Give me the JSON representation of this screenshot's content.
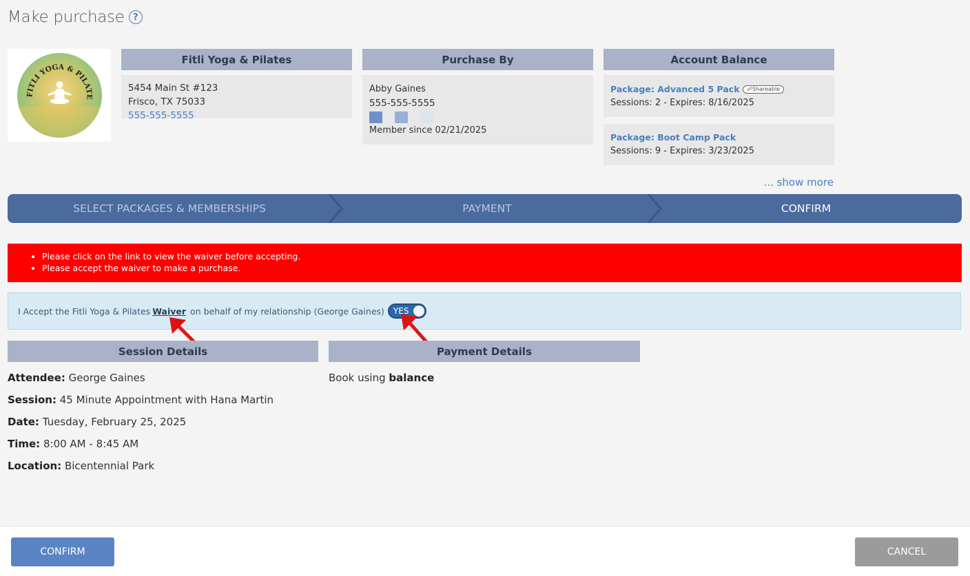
{
  "header": {
    "title": "Make purchase",
    "help_icon": "question-circle-icon"
  },
  "business": {
    "logo_text": "FITLI YOGA & PILATES",
    "name": "Fitli Yoga & Pilates",
    "address_line1": "5454 Main St #123",
    "address_line2": "Frisco, TX 75033",
    "phone": "555-555-5555"
  },
  "purchaser": {
    "heading": "Purchase By",
    "name": "Abby Gaines",
    "phone": "555-555-5555",
    "member_since": "Member since 02/21/2025"
  },
  "account": {
    "heading": "Account Balance",
    "packages": [
      {
        "title": "Package: Advanced 5 Pack",
        "badge": "Shareable",
        "details": "Sessions: 2 -  Expires: 8/16/2025"
      },
      {
        "title": "Package: Boot Camp Pack",
        "details": "Sessions: 9 -  Expires: 3/23/2025"
      }
    ],
    "show_more": "... show more"
  },
  "steps": [
    "SELECT PACKAGES & MEMBERSHIPS",
    "PAYMENT",
    "CONFIRM"
  ],
  "errors": [
    "Please click on the link to view the waiver before accepting.",
    "Please accept the waiver to make a purchase."
  ],
  "waiver": {
    "prefix": "I Accept the Fitli Yoga & Pilates",
    "link": "Waiver",
    "suffix": "on behalf of my relationship (George Gaines)",
    "toggle": "YES"
  },
  "session": {
    "heading": "Session Details",
    "rows": [
      {
        "label": "Attendee:",
        "value": "George Gaines"
      },
      {
        "label": "Session:",
        "value": "45 Minute Appointment with Hana Martin"
      },
      {
        "label": "Date:",
        "value": "Tuesday, February 25, 2025"
      },
      {
        "label": "Time:",
        "value": "8:00 AM - 8:45 AM"
      },
      {
        "label": "Location:",
        "value": "Bicentennial Park"
      }
    ]
  },
  "payment": {
    "heading": "Payment Details",
    "text": "Book using",
    "method": "balance"
  },
  "footer": {
    "confirm": "CONFIRM",
    "cancel": "CANCEL"
  },
  "colors": {
    "accent": "#4b6a9e",
    "error": "#ff0000",
    "link": "#4a7fbf",
    "annotation_arrow": "#e01010"
  }
}
